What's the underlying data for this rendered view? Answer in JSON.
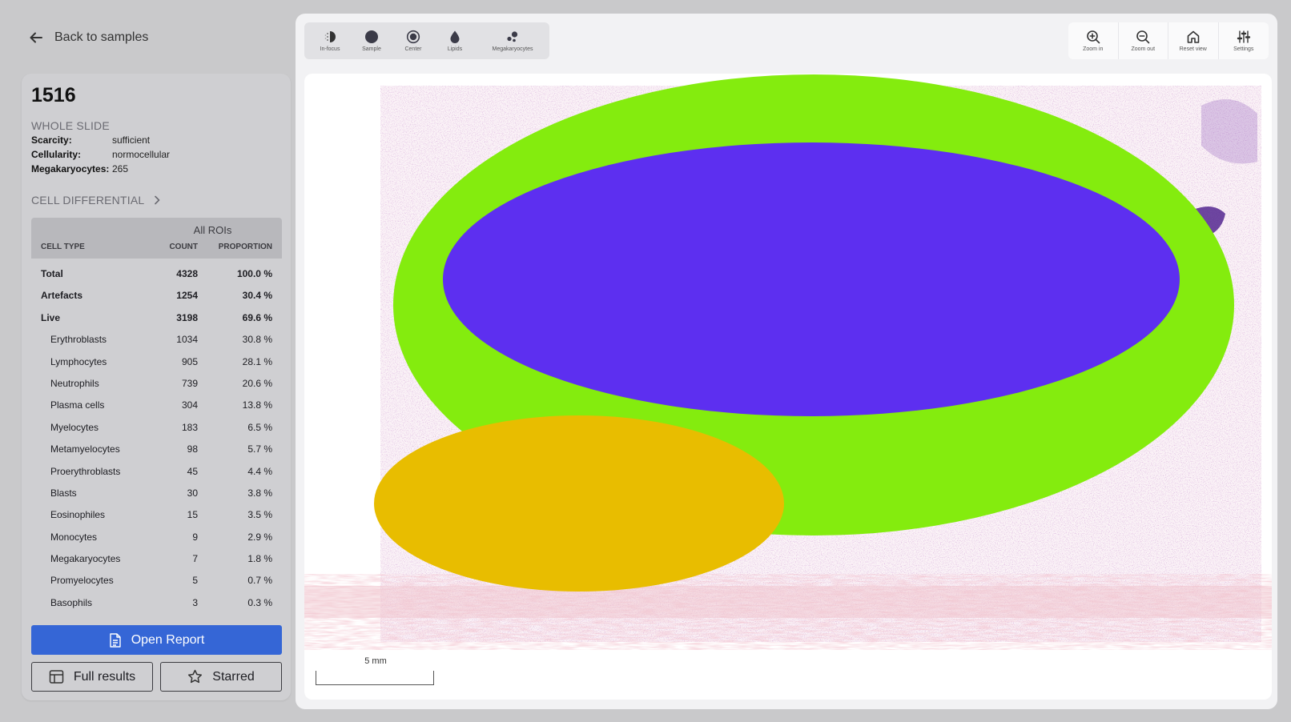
{
  "nav": {
    "back_label": "Back to samples"
  },
  "sample": {
    "id": "1516",
    "whole_slide_label": "WHOLE SLIDE",
    "fields": [
      {
        "key": "Scarcity:",
        "value": "sufficient"
      },
      {
        "key": "Cellularity:",
        "value": "normocellular"
      },
      {
        "key": "Megakaryocytes:",
        "value": "265"
      }
    ],
    "cell_differential_label": "CELL DIFFERENTIAL"
  },
  "table": {
    "group_header": "All ROIs",
    "columns": [
      "CELL TYPE",
      "COUNT",
      "PROPORTION"
    ],
    "rows": [
      {
        "name": "Total",
        "count": "4328",
        "proportion": "100.0 %",
        "bold": true,
        "sub": false
      },
      {
        "name": "Artefacts",
        "count": "1254",
        "proportion": "30.4 %",
        "bold": true,
        "sub": false
      },
      {
        "name": "Live",
        "count": "3198",
        "proportion": "69.6 %",
        "bold": true,
        "sub": false
      },
      {
        "name": "Erythroblasts",
        "count": "1034",
        "proportion": "30.8 %",
        "bold": false,
        "sub": true
      },
      {
        "name": "Lymphocytes",
        "count": "905",
        "proportion": "28.1 %",
        "bold": false,
        "sub": true
      },
      {
        "name": "Neutrophils",
        "count": "739",
        "proportion": "20.6 %",
        "bold": false,
        "sub": true
      },
      {
        "name": "Plasma cells",
        "count": "304",
        "proportion": "13.8 %",
        "bold": false,
        "sub": true
      },
      {
        "name": "Myelocytes",
        "count": "183",
        "proportion": "6.5 %",
        "bold": false,
        "sub": true
      },
      {
        "name": "Metamyelocytes",
        "count": "98",
        "proportion": "5.7 %",
        "bold": false,
        "sub": true
      },
      {
        "name": "Proerythroblasts",
        "count": "45",
        "proportion": "4.4 %",
        "bold": false,
        "sub": true
      },
      {
        "name": "Blasts",
        "count": "30",
        "proportion": "3.8 %",
        "bold": false,
        "sub": true
      },
      {
        "name": "Eosinophiles",
        "count": "15",
        "proportion": "3.5 %",
        "bold": false,
        "sub": true
      },
      {
        "name": "Monocytes",
        "count": "9",
        "proportion": "2.9 %",
        "bold": false,
        "sub": true
      },
      {
        "name": "Megakaryocytes",
        "count": "7",
        "proportion": "1.8 %",
        "bold": false,
        "sub": true
      },
      {
        "name": "Promyelocytes",
        "count": "5",
        "proportion": "0.7 %",
        "bold": false,
        "sub": true
      },
      {
        "name": "Basophils",
        "count": "3",
        "proportion": "0.3 %",
        "bold": false,
        "sub": true
      }
    ]
  },
  "actions": {
    "open_report": "Open Report",
    "full_results": "Full results",
    "starred": "Starred"
  },
  "toolbar": {
    "layers": [
      {
        "label": "In-focus",
        "icon": "in-focus-icon"
      },
      {
        "label": "Sample",
        "icon": "sample-icon"
      },
      {
        "label": "Center",
        "icon": "center-icon"
      },
      {
        "label": "Lipids",
        "icon": "lipids-icon"
      },
      {
        "label": "Megakaryocytes",
        "icon": "megakaryocytes-icon"
      }
    ],
    "view": [
      {
        "label": "Zoom in",
        "icon": "zoom-in-icon"
      },
      {
        "label": "Zoom out",
        "icon": "zoom-out-icon"
      },
      {
        "label": "Reset view",
        "icon": "home-icon"
      },
      {
        "label": "Settings",
        "icon": "sliders-icon"
      }
    ]
  },
  "viewer": {
    "scale_label": "5 mm",
    "overlay_colors": {
      "green": "#84ec0e",
      "violet": "#5d2ff0",
      "yellow": "#e8bd00"
    },
    "accent": "#3566d6"
  }
}
